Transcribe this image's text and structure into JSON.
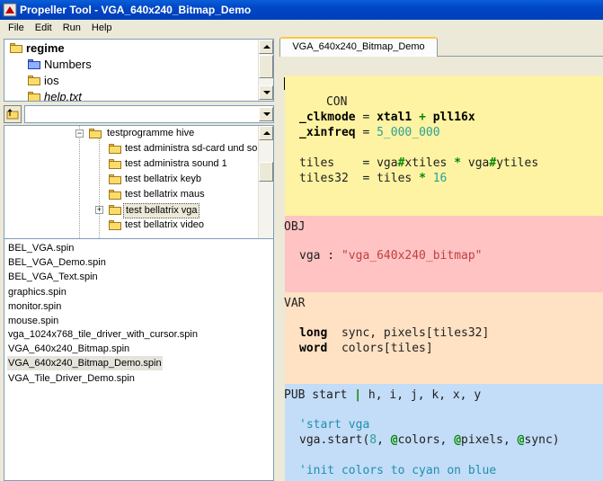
{
  "window": {
    "title": "Propeller Tool - VGA_640x240_Bitmap_Demo"
  },
  "menu": [
    "File",
    "Edit",
    "Run",
    "Help"
  ],
  "tree1": {
    "items": [
      {
        "label": "regime",
        "icon": "folder-icon"
      },
      {
        "label": "Numbers",
        "icon": "folder-blue-icon"
      },
      {
        "label": "ios",
        "icon": "folder-icon"
      },
      {
        "label": "help.txt",
        "icon": "folder-icon"
      }
    ]
  },
  "tree2": {
    "items": [
      {
        "label": "testprogramme hive"
      },
      {
        "label": "test administra sd-card und sou"
      },
      {
        "label": "test administra sound 1"
      },
      {
        "label": "test bellatrix keyb"
      },
      {
        "label": "test bellatrix maus"
      },
      {
        "label": "test bellatrix vga"
      },
      {
        "label": "test bellatrix video"
      }
    ]
  },
  "files": [
    "BEL_VGA.spin",
    "BEL_VGA_Demo.spin",
    "BEL_VGA_Text.spin",
    "graphics.spin",
    "monitor.spin",
    "mouse.spin",
    "vga_1024x768_tile_driver_with_cursor.spin",
    "VGA_640x240_Bitmap.spin",
    "VGA_640x240_Bitmap_Demo.spin",
    "VGA_Tile_Driver_Demo.spin"
  ],
  "editor": {
    "tab_label": "VGA_640x240_Bitmap_Demo",
    "sections": {
      "con": "CON",
      "obj": "OBJ",
      "var": "VAR",
      "pub": "PUB"
    },
    "code": {
      "clkmode_name": "_clkmode",
      "clkmode_eq": " = ",
      "clkmode_xtal": "xtal1",
      "clkmode_plus": " + ",
      "clkmode_pll": "pll16x",
      "xinfreq_name": "_xinfreq",
      "xinfreq_eq": " = ",
      "xinfreq_val": "5_000_000",
      "tiles_name": "tiles",
      "tiles_expr1": "    = vga",
      "tiles_hash1": "#",
      "tiles_expr2": "xtiles ",
      "tiles_star": "*",
      "tiles_expr3": " vga",
      "tiles_hash2": "#",
      "tiles_expr4": "ytiles",
      "tiles32_name": "tiles32",
      "tiles32_expr": "  = tiles ",
      "tiles32_star": "*",
      "tiles32_num": " 16",
      "obj_name": "vga",
      "obj_colon": " : ",
      "obj_str": "\"vga_640x240_bitmap\"",
      "long_kw": "long",
      "long_rest": "  sync, pixels[tiles32]",
      "word_kw": "word",
      "word_rest": "  colors[tiles]",
      "pub_start": " start ",
      "pub_bar": "|",
      "pub_locals": " h, i, j, k, x, y",
      "cmt_start": "'start vga",
      "start_call1": "vga.start(",
      "start_num": "8",
      "start_call2": ", ",
      "start_at1": "@",
      "start_call3": "colors, ",
      "start_at2": "@",
      "start_call4": "pixels, ",
      "start_at3": "@",
      "start_call5": "sync)",
      "cmt_init": "'init colors to cyan on blue"
    }
  },
  "colors": {
    "titlebar": "#0046c6",
    "con_bg": "#fdf3a2",
    "obj_bg": "#ffc3c3",
    "var_bg": "#ffe1c4",
    "pub_bg": "#c3dcf7"
  }
}
